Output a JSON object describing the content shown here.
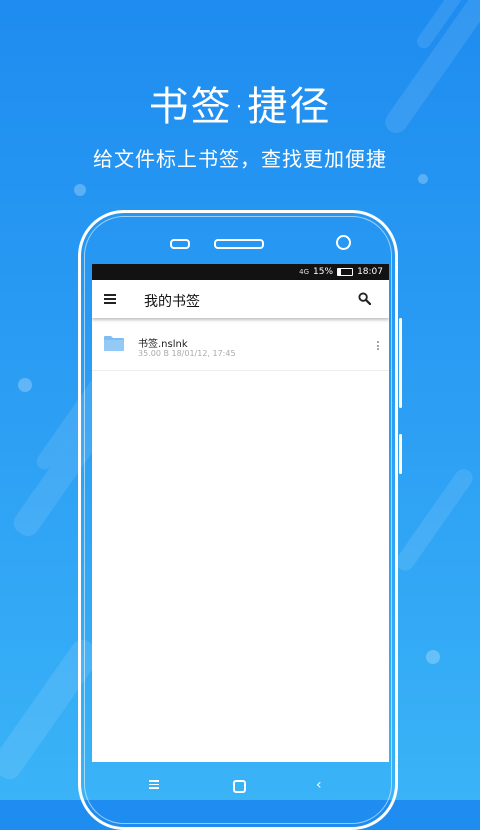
{
  "hero": {
    "headline": "书签·捷径",
    "subline": "给文件标上书签，查找更加便捷"
  },
  "statusbar": {
    "signal": "4G",
    "battery": "15%",
    "time": "18:07"
  },
  "appbar": {
    "title": "我的书签"
  },
  "files": [
    {
      "name": "书签.nslnk",
      "meta": "35.00 B 18/01/12, 17:45"
    }
  ],
  "colors": {
    "background_top": "#1e8cf0",
    "background_bottom": "#3ab3f7",
    "folder": "#7ebdf2"
  },
  "icons": [
    "menu-icon",
    "search-icon",
    "folder-icon",
    "more-vertical-icon",
    "nav-menu-icon",
    "nav-home-icon",
    "nav-back-icon"
  ]
}
